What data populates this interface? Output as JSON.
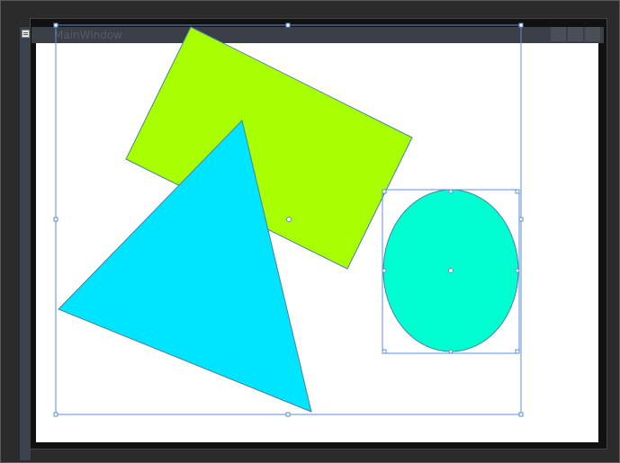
{
  "window": {
    "title": "MainWindow"
  },
  "shapes": {
    "rectangle": {
      "name": "rotated-rectangle",
      "fill": "#a8ff00"
    },
    "triangle": {
      "name": "triangle",
      "fill": "#00e5ff"
    },
    "ellipse": {
      "name": "ellipse",
      "fill": "#00ffd0"
    }
  },
  "colors": {
    "selection": "#5b8fd9",
    "shape_stroke": "#4a7fa8"
  }
}
